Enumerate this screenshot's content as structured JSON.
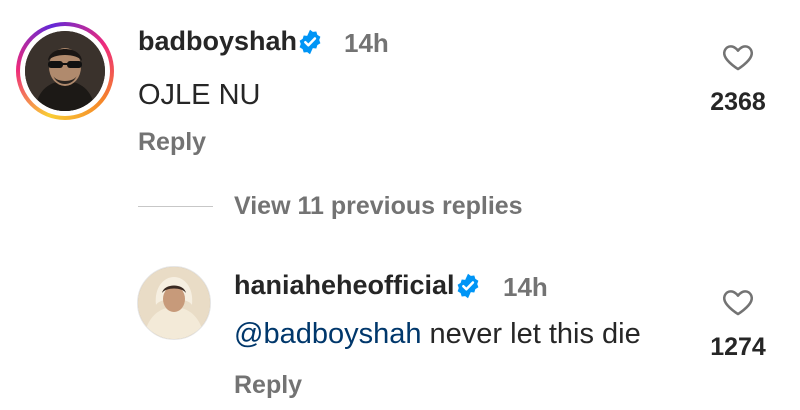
{
  "comment": {
    "username": "badboyshah",
    "verified_icon": "verified-badge-icon",
    "time": "14h",
    "text": "OJLE NU",
    "reply_label": "Reply",
    "like_icon": "heart-outline-icon",
    "likes": "2368"
  },
  "thread": {
    "view_replies_label": "View 11 previous replies"
  },
  "reply": {
    "username": "haniaheheofficial",
    "verified_icon": "verified-badge-icon",
    "time": "14h",
    "mention": "@badboyshah",
    "text": "never let this die",
    "reply_label": "Reply",
    "like_icon": "heart-outline-icon",
    "likes": "1274"
  },
  "colors": {
    "verified_blue": "#0095f6",
    "secondary_text": "#737373",
    "mention_link": "#00376b"
  }
}
